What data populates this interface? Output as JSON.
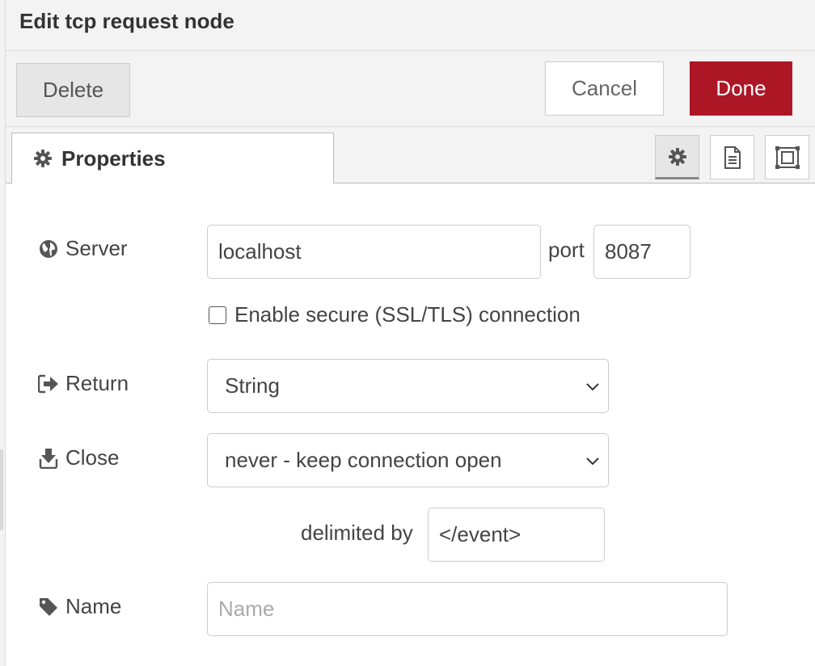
{
  "tray": {
    "title": "Edit tcp request node"
  },
  "toolbar": {
    "delete_label": "Delete",
    "cancel_label": "Cancel",
    "done_label": "Done",
    "done_color": "#ad1625"
  },
  "tabs": {
    "properties_label": "Properties",
    "properties_icon": "gear-icon",
    "icon_tabs": [
      {
        "name": "settings-tab",
        "icon": "gear-icon",
        "selected": true
      },
      {
        "name": "description-tab",
        "icon": "file-text-icon",
        "selected": false
      },
      {
        "name": "appearance-tab",
        "icon": "frame-icon",
        "selected": false
      }
    ]
  },
  "form": {
    "server": {
      "label": "Server",
      "icon": "globe-icon",
      "value": "localhost",
      "port_label": "port",
      "port_value": "8087"
    },
    "tls": {
      "label": "Enable secure (SSL/TLS) connection",
      "checked": false
    },
    "return": {
      "label": "Return",
      "icon": "sign-out-icon",
      "selected": "String"
    },
    "close": {
      "label": "Close",
      "icon": "download-icon",
      "selected": "never - keep connection open"
    },
    "delimiter": {
      "label": "delimited by",
      "value": "</event>"
    },
    "name": {
      "label": "Name",
      "icon": "tag-icon",
      "value": "",
      "placeholder": "Name"
    }
  }
}
